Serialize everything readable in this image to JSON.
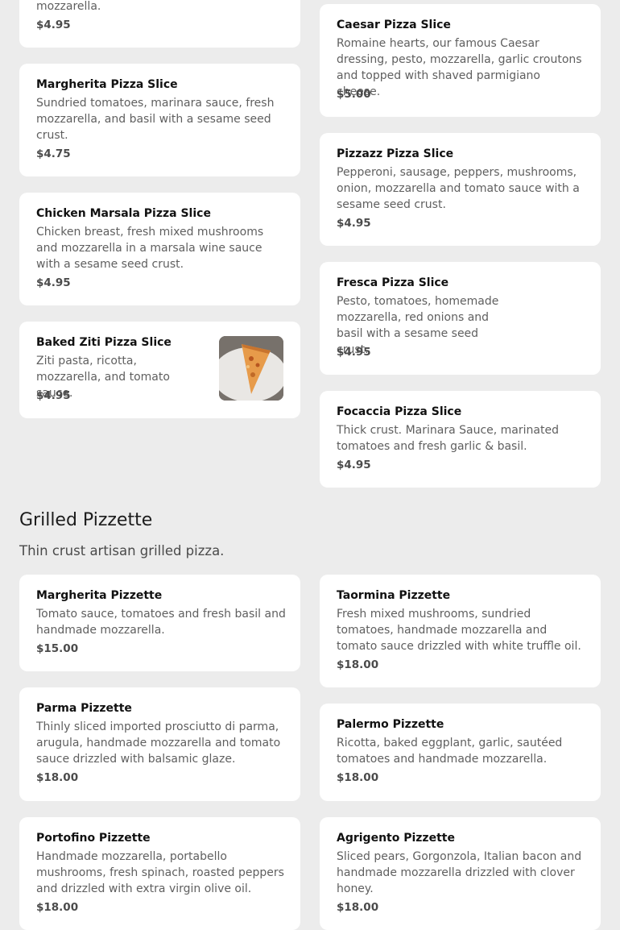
{
  "top_partial": {
    "desc": "mozzarella.",
    "price": "$4.95"
  },
  "left_items": [
    {
      "name": "Margherita Pizza Slice",
      "desc": "Sundried tomatoes, marinara sauce, fresh mozzarella, and basil with a sesame seed crust.",
      "price": "$4.75"
    },
    {
      "name": "Chicken Marsala Pizza Slice",
      "desc": "Chicken breast, fresh mixed mushrooms and mozzarella in a marsala wine sauce with a sesame seed crust.",
      "price": "$4.95"
    },
    {
      "name": "Baked Ziti Pizza Slice",
      "desc": "Ziti pasta, ricotta, mozzarella, and tomato sauce.",
      "price": "$4.95",
      "image": "pizza-slice-photo"
    }
  ],
  "right_items": [
    {
      "name": "Caesar Pizza Slice",
      "desc": "Romaine hearts, our famous Caesar dressing, pesto, mozzarella, garlic croutons and topped with shaved parmigiano cheese.",
      "price": "$5.00"
    },
    {
      "name": "Pizzazz Pizza Slice",
      "desc": "Pepperoni, sausage, peppers, mushrooms, onion, mozzarella and tomato sauce with a sesame seed crust.",
      "price": "$4.95"
    },
    {
      "name": "Fresca Pizza Slice",
      "desc": "Pesto, tomatoes, homemade mozzarella, red onions and basil with a sesame seed crust.",
      "price": "$4.95"
    },
    {
      "name": "Focaccia Pizza Slice",
      "desc": "Thick crust. Marinara Sauce, marinated tomatoes and fresh garlic & basil.",
      "price": "$4.95"
    }
  ],
  "section": {
    "title": "Grilled Pizzette",
    "subtitle": "Thin crust artisan grilled pizza."
  },
  "pizzette_left": [
    {
      "name": "Margherita Pizzette",
      "desc": "Tomato sauce, tomatoes and fresh basil and handmade mozzarella.",
      "price": "$15.00"
    },
    {
      "name": "Parma Pizzette",
      "desc": "Thinly sliced imported prosciutto di parma, arugula, handmade mozzarella and tomato sauce drizzled with balsamic glaze.",
      "price": "$18.00"
    },
    {
      "name": "Portofino Pizzette",
      "desc": "Handmade mozzarella, portabello mushrooms, fresh spinach, roasted peppers and drizzled with extra virgin olive oil.",
      "price": "$18.00"
    }
  ],
  "pizzette_right": [
    {
      "name": "Taormina Pizzette",
      "desc": "Fresh mixed mushrooms, sundried tomatoes, handmade mozzarella and tomato sauce drizzled with white truffle oil.",
      "price": "$18.00"
    },
    {
      "name": "Palermo Pizzette",
      "desc": "Ricotta, baked eggplant, garlic, sautéed tomatoes and handmade mozzarella.",
      "price": "$18.00"
    },
    {
      "name": "Agrigento Pizzette",
      "desc": "Sliced pears, Gorgonzola, Italian bacon and handmade mozzarella drizzled with clover honey.",
      "price": "$18.00"
    }
  ]
}
